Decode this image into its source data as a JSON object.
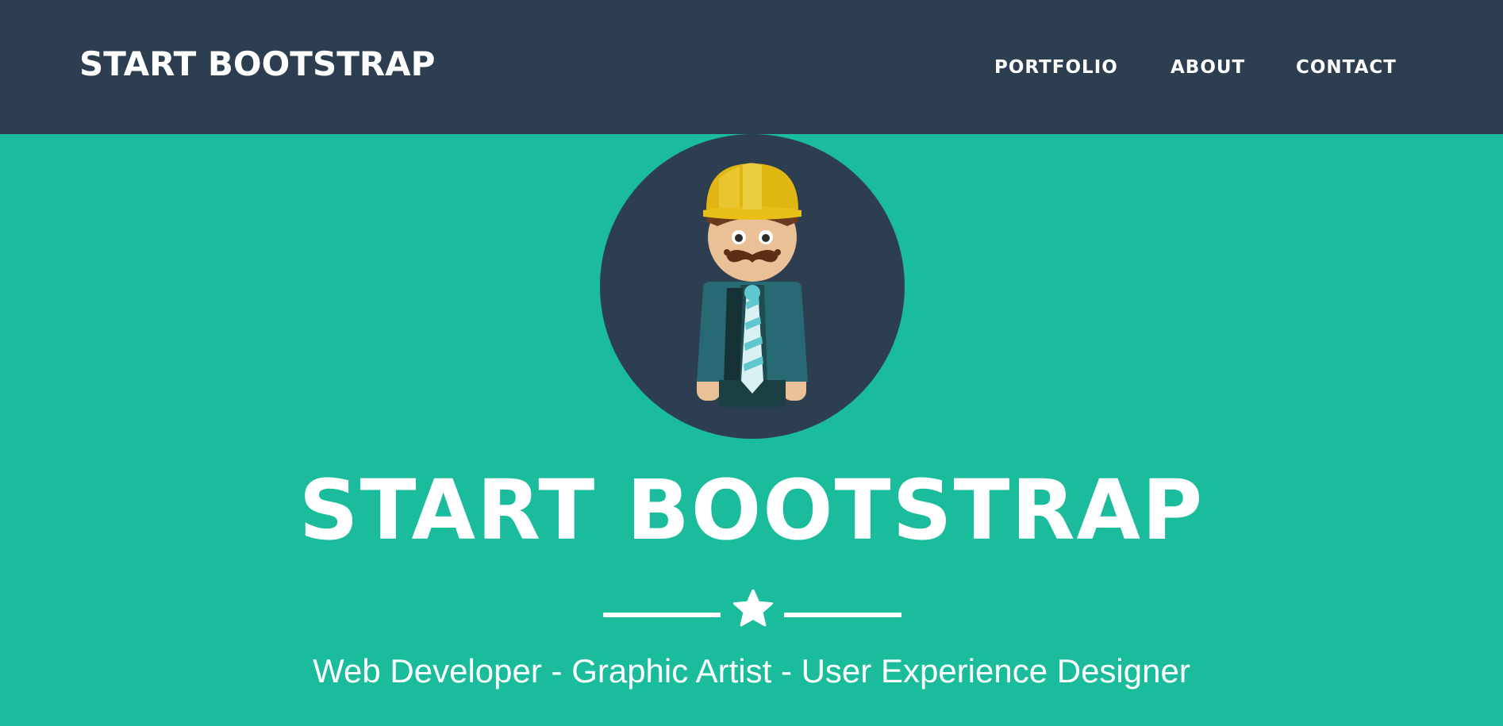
{
  "navbar": {
    "brand": "START BOOTSTRAP",
    "links": [
      {
        "label": "PORTFOLIO"
      },
      {
        "label": "ABOUT"
      },
      {
        "label": "CONTACT"
      }
    ]
  },
  "masthead": {
    "avatar_icon": "construction-worker-avatar",
    "title": "START BOOTSTRAP",
    "divider_icon": "star-icon",
    "subtitle": "Web Developer - Graphic Artist - User Experience Designer"
  },
  "colors": {
    "navbar_bg": "#2c3e50",
    "hero_bg": "#1abc9c",
    "text": "#ffffff"
  }
}
